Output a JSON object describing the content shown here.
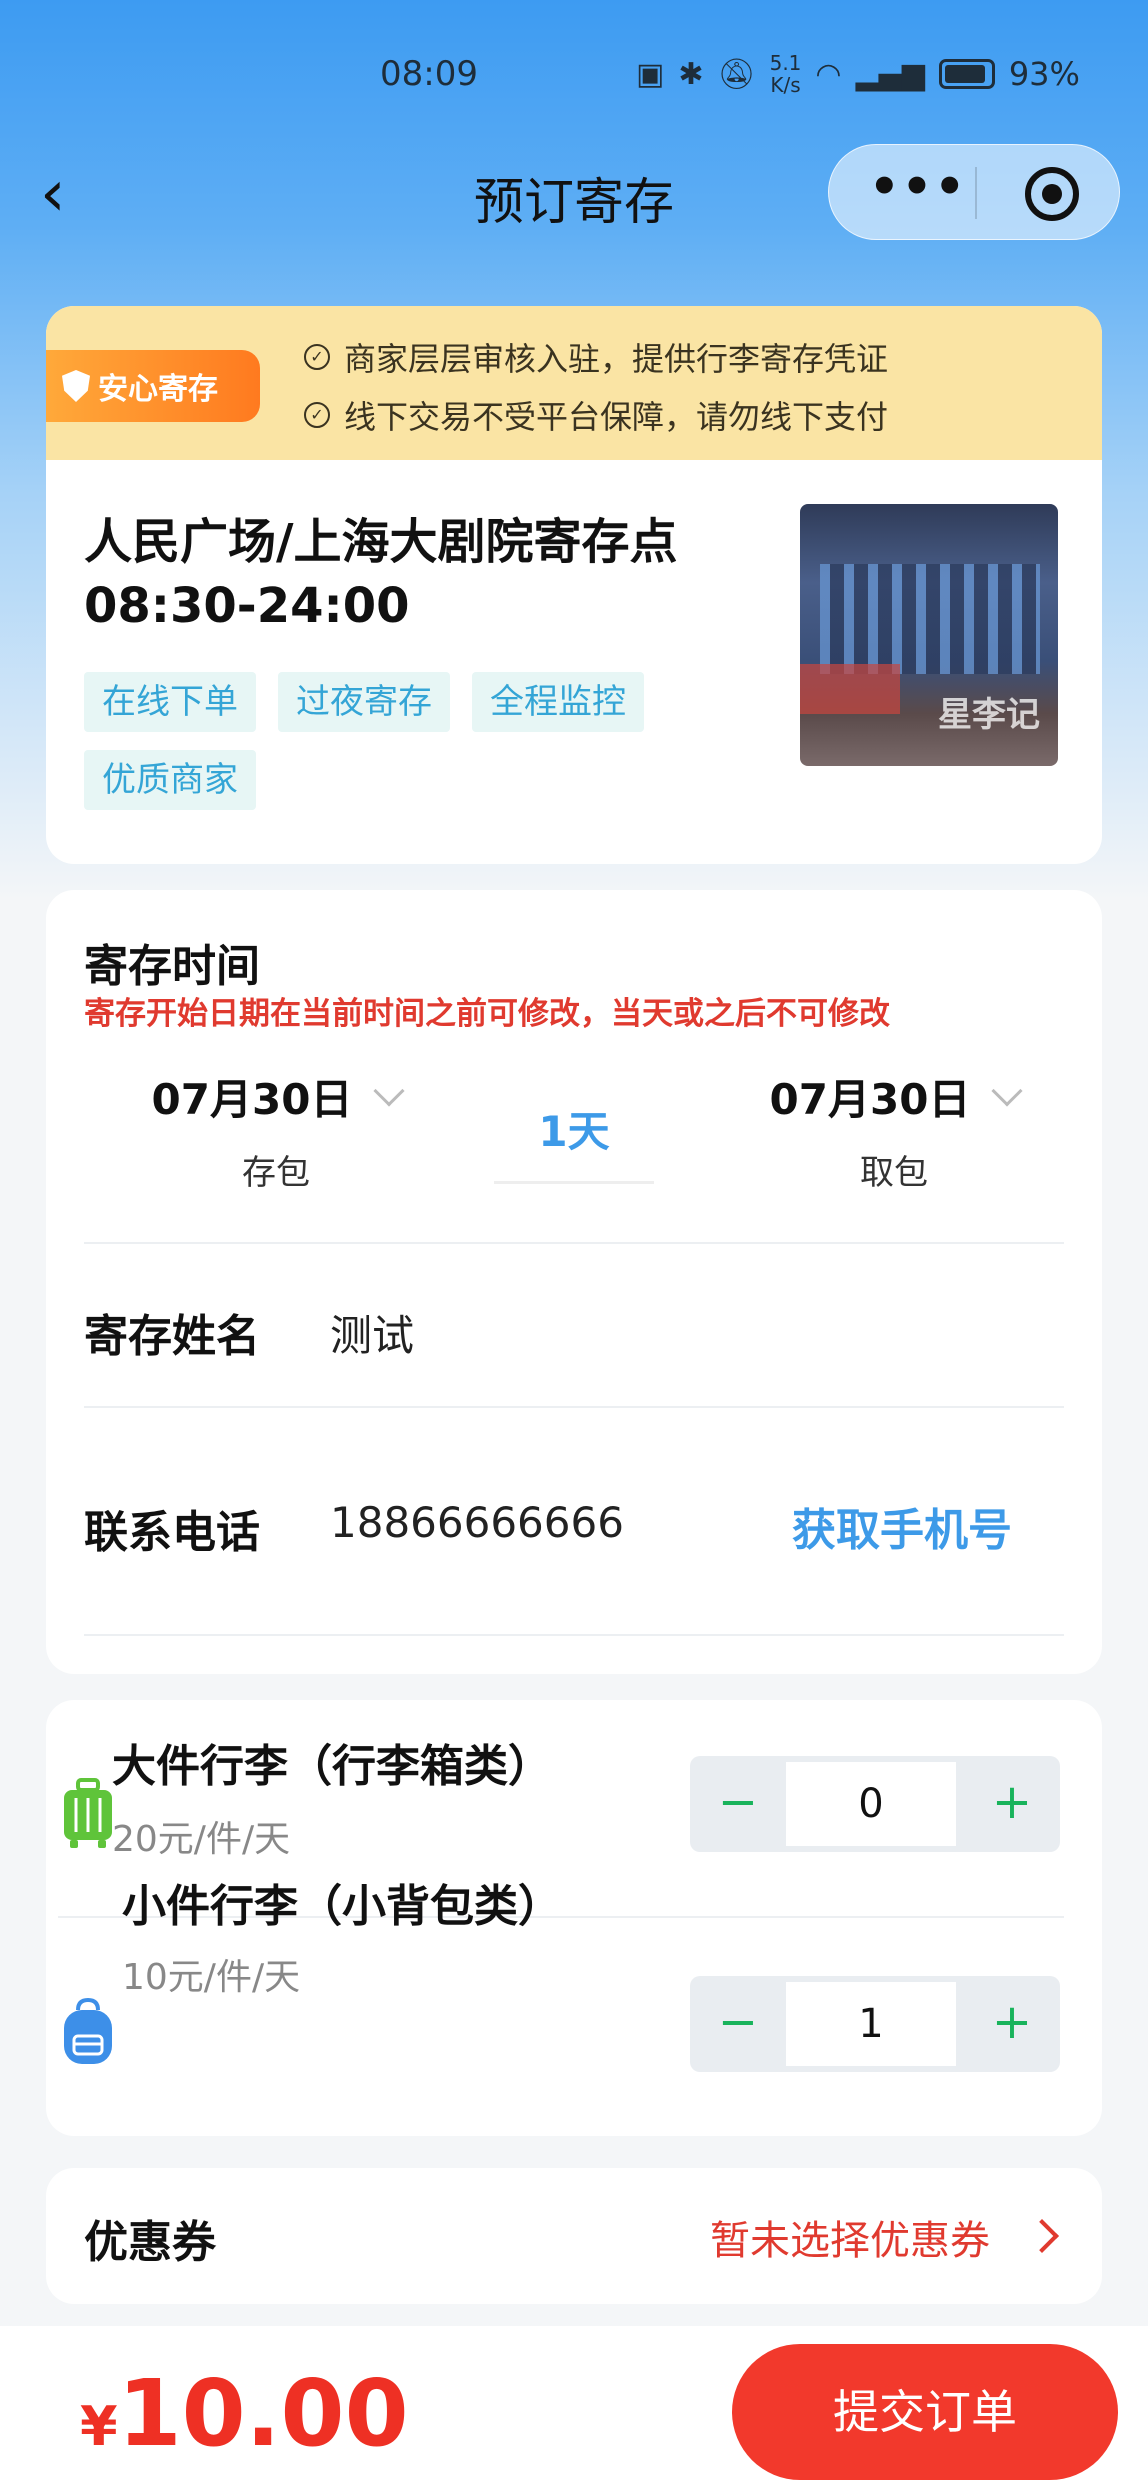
{
  "status_bar": {
    "time": "08:09",
    "icons": [
      "nfc-icon",
      "bluetooth-icon",
      "mute-icon",
      "wifi-icon",
      "signal-icon"
    ],
    "net_speed": "5.1\nK/s",
    "battery": "93%"
  },
  "nav": {
    "title": "预订寄存",
    "more": "•••"
  },
  "notice": {
    "badge": "安心寄存",
    "lines": [
      "商家层层审核入驻，提供行李寄存凭证",
      "线下交易不受平台保障，请勿线下支付"
    ]
  },
  "store": {
    "name": "人民广场/上海大剧院寄存点",
    "hours": "08:30-24:00",
    "tags": [
      "在线下单",
      "过夜寄存",
      "全程监控",
      "优质商家"
    ],
    "image_watermark": "星李记"
  },
  "form": {
    "title": "寄存时间",
    "warning": "寄存开始日期在当前时间之前可修改，当天或之后不可修改",
    "drop_date": "07月30日",
    "drop_label": "存包",
    "days": "1天",
    "pick_date": "07月30日",
    "pick_label": "取包",
    "name_label": "寄存姓名",
    "name_value": "测试",
    "phone_label": "联系电话",
    "phone_value": "18866666666",
    "get_phone": "获取手机号"
  },
  "luggage": [
    {
      "name": "大件行李（行李箱类）",
      "price": "20元/件/天",
      "qty": "0",
      "icon": "suitcase-icon",
      "color": "#5fc43a"
    },
    {
      "name": "小件行李（小背包类）",
      "price": "10元/件/天",
      "qty": "1",
      "icon": "backpack-icon",
      "color": "#3d8fe8"
    }
  ],
  "stepper": {
    "minus": "−",
    "plus": "+"
  },
  "coupon": {
    "label": "优惠券",
    "value": "暂未选择优惠券"
  },
  "footer": {
    "currency": "¥",
    "total": "10.00",
    "submit": "提交订单"
  },
  "colors": {
    "accent_blue": "#3d9ae8",
    "price_red": "#ee3024",
    "stepper_green": "#19b35c",
    "badge_orange": "#ff7a1f"
  }
}
